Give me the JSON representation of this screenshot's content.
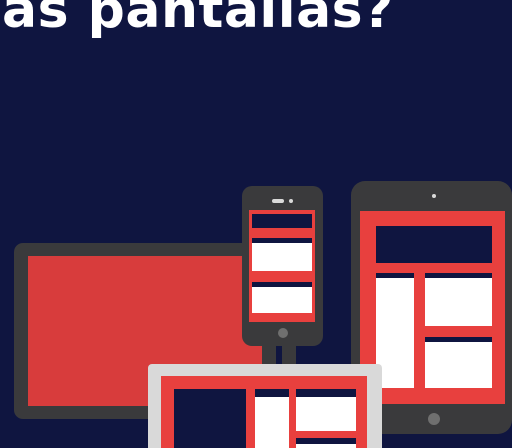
{
  "headline": {
    "text": "as pantallas?"
  },
  "colors": {
    "background": "#0f1540",
    "device_body": "#3a3a3c",
    "screen_accent": "#e8403e",
    "desktop_screen": "#d83c3c",
    "content_block": "#ffffff",
    "header_bar": "#0f1540",
    "laptop_frame": "#d9d9d9",
    "button": "#6f6f6f"
  },
  "illustration": {
    "devices": [
      "desktop-monitor",
      "smartphone",
      "tablet",
      "laptop"
    ]
  }
}
